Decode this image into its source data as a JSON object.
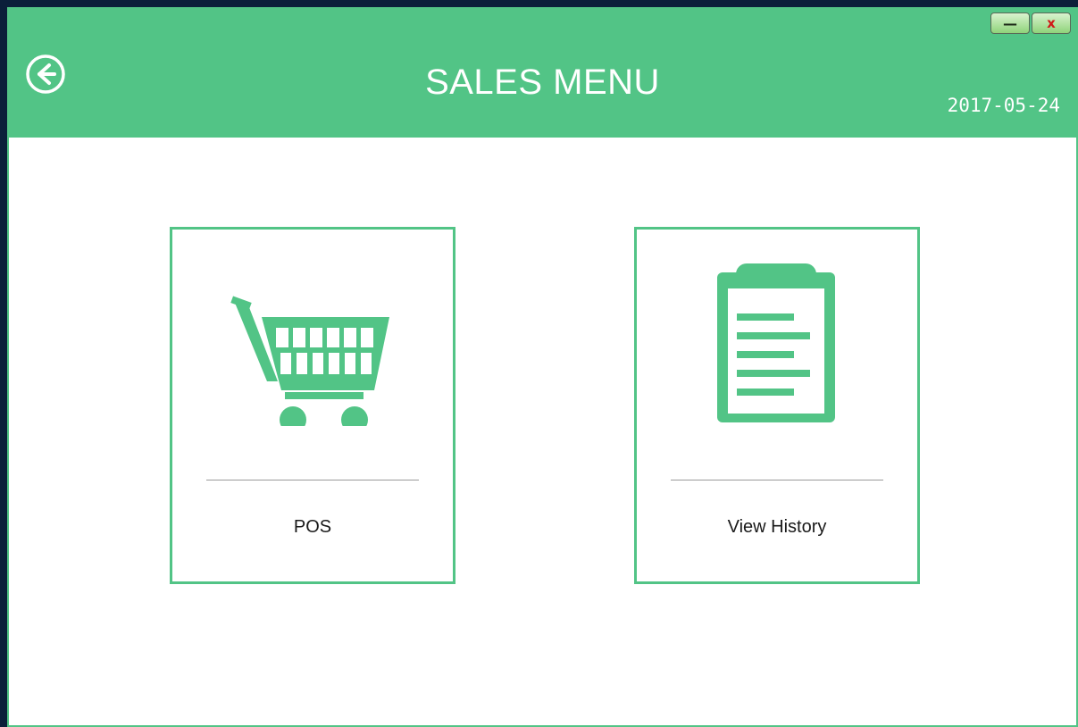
{
  "header": {
    "title": "SALES MENU",
    "date": "2017-05-24",
    "back_icon": "arrow-left-circle-icon"
  },
  "window_controls": {
    "minimize_label": "—",
    "close_label": "x"
  },
  "cards": [
    {
      "label": "POS",
      "icon": "shopping-cart-icon"
    },
    {
      "label": "View History",
      "icon": "clipboard-icon"
    }
  ],
  "colors": {
    "accent": "#52c486",
    "background": "#ffffff",
    "close_glyph": "#d01818"
  }
}
